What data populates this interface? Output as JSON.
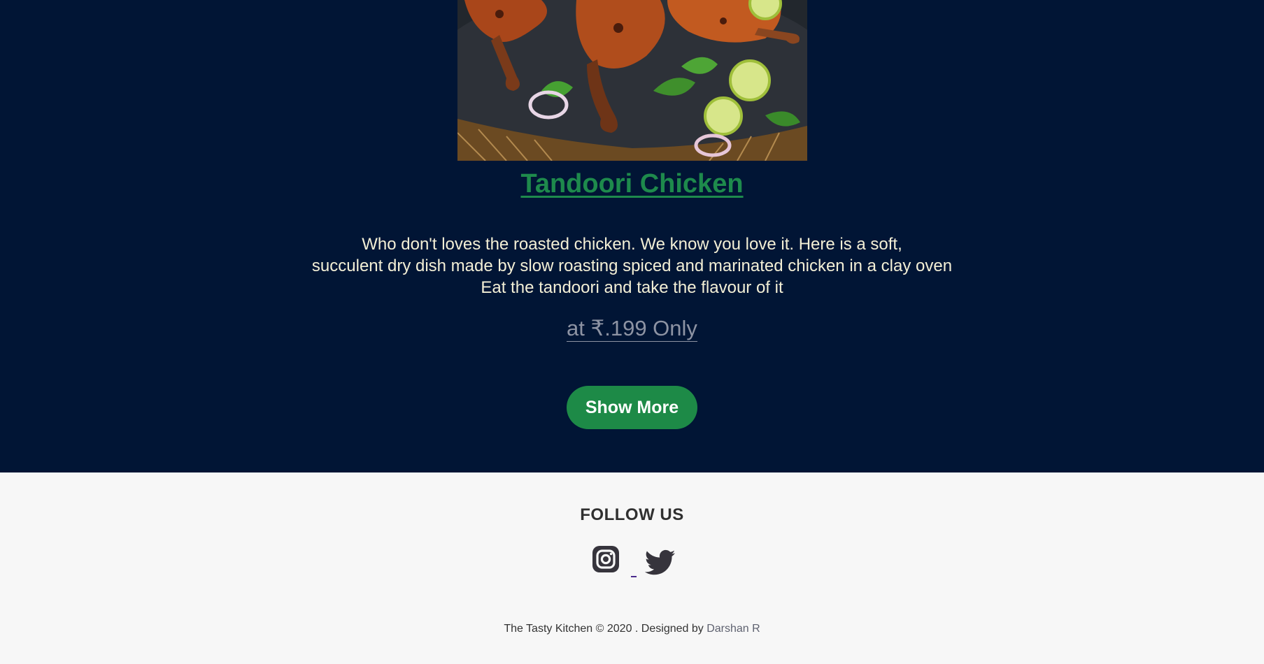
{
  "dish": {
    "image_alt": "Tandoori Chicken photo",
    "title": "Tandoori Chicken",
    "description": [
      "Who don't loves the roasted chicken. We know you love it. Here is a soft,",
      "succulent dry dish made by slow roasting spiced and marinated chicken in a clay oven",
      "Eat the tandoori and take the flavour of it"
    ],
    "price": "at ₹.199 Only",
    "button_label": "Show More"
  },
  "footer": {
    "follow_label": "FOLLOW US",
    "social": [
      {
        "icon": "instagram-icon"
      },
      {
        "icon": "twitter-icon"
      }
    ],
    "copyright_text": "The Tasty Kitchen © 2020 . Designed by ",
    "designer": "Darshan R"
  },
  "colors": {
    "hero_bg": "#011535",
    "title_green": "#1e8a4c",
    "button_green": "#1d8a47",
    "footer_bg": "#f7f7f7",
    "icon_dark": "#36343c"
  }
}
